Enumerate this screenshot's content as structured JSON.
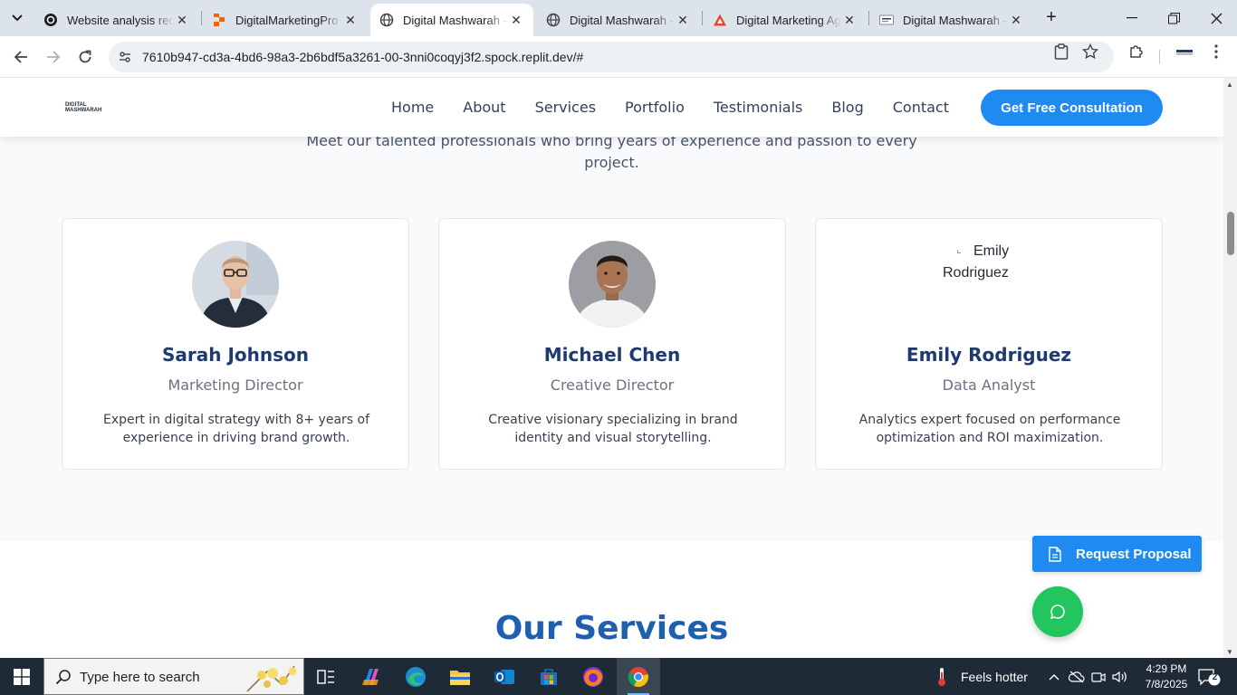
{
  "browser": {
    "tabs": [
      {
        "title": "Website analysis requ",
        "favicon": "openai-icon"
      },
      {
        "title": "DigitalMarketingPro -",
        "favicon": "replit-icon"
      },
      {
        "title": "Digital Mashwarah - l",
        "favicon": "globe-icon",
        "active": true
      },
      {
        "title": "Digital Mashwarah - l",
        "favicon": "globe-icon"
      },
      {
        "title": "Digital Marketing Ag",
        "favicon": "warning-icon"
      },
      {
        "title": "Digital Mashwarah – l",
        "favicon": "site-logo-icon"
      }
    ],
    "url": "7610b947-cd3a-4bd6-98a3-2b6bdf5a3261-00-3nni0coqyj3f2.spock.replit.dev/#"
  },
  "site": {
    "logo_text": "DIGITAL MASHWARAH",
    "nav": [
      "Home",
      "About",
      "Services",
      "Portfolio",
      "Testimonials",
      "Blog",
      "Contact"
    ],
    "cta_label": "Get Free Consultation",
    "team_intro": "Meet our talented professionals who bring years of experience and passion to every project.",
    "team": [
      {
        "name": "Sarah Johnson",
        "role": "Marketing Director",
        "bio": "Expert in digital strategy with 8+ years of experience in driving brand growth.",
        "photo_alt": ""
      },
      {
        "name": "Michael Chen",
        "role": "Creative Director",
        "bio": "Creative visionary specializing in brand identity and visual storytelling.",
        "photo_alt": ""
      },
      {
        "name": "Emily Rodriguez",
        "role": "Data Analyst",
        "bio": "Analytics expert focused on performance optimization and ROI maximization.",
        "photo_alt": "Emily Rodriguez"
      }
    ],
    "services_title": "Our Services",
    "proposal_label": "Request Proposal"
  },
  "taskbar": {
    "search_placeholder": "Type here to search",
    "weather": "Feels hotter",
    "time": "4:29 PM",
    "date": "7/8/2025",
    "notifications": "2"
  },
  "colors": {
    "accent": "#1f8bf0",
    "heading": "#1e3a6e",
    "services_heading": "#1e5fb0",
    "chat_green": "#22c55e"
  }
}
